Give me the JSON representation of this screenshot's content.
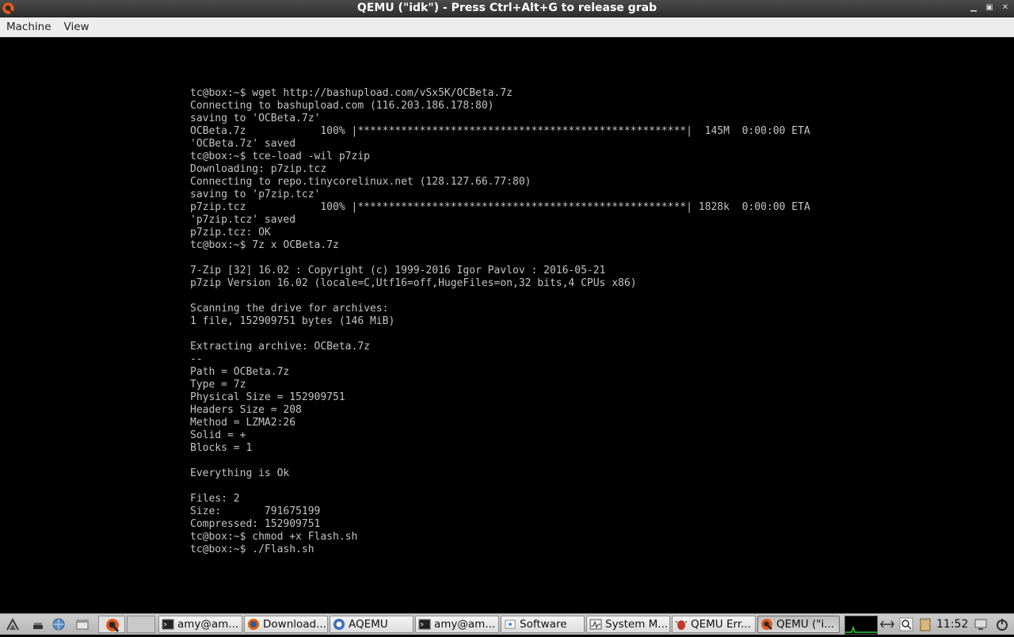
{
  "window": {
    "title": "QEMU (\"idk\") - Press Ctrl+Alt+G to release grab"
  },
  "menu": [
    "Machine",
    "View"
  ],
  "terminal": {
    "lines": [
      "tc@box:~$ wget http://bashupload.com/vSx5K/OCBeta.7z",
      "Connecting to bashupload.com (116.203.186.178:80)",
      "saving to 'OCBeta.7z'",
      "OCBeta.7z            100% |*****************************************************|  145M  0:00:00 ETA",
      "'OCBeta.7z' saved",
      "tc@box:~$ tce-load -wil p7zip",
      "Downloading: p7zip.tcz",
      "Connecting to repo.tinycorelinux.net (128.127.66.77:80)",
      "saving to 'p7zip.tcz'",
      "p7zip.tcz            100% |*****************************************************| 1828k  0:00:00 ETA",
      "'p7zip.tcz' saved",
      "p7zip.tcz: OK",
      "tc@box:~$ 7z x OCBeta.7z",
      "",
      "7-Zip [32] 16.02 : Copyright (c) 1999-2016 Igor Pavlov : 2016-05-21",
      "p7zip Version 16.02 (locale=C,Utf16=off,HugeFiles=on,32 bits,4 CPUs x86)",
      "",
      "Scanning the drive for archives:",
      "1 file, 152909751 bytes (146 MiB)",
      "",
      "Extracting archive: OCBeta.7z",
      "--",
      "Path = OCBeta.7z",
      "Type = 7z",
      "Physical Size = 152909751",
      "Headers Size = 208",
      "Method = LZMA2:26",
      "Solid = +",
      "Blocks = 1",
      "",
      "Everything is Ok",
      "",
      "Files: 2",
      "Size:       791675199",
      "Compressed: 152909751",
      "tc@box:~$ chmod +x Flash.sh",
      "tc@box:~$ ./Flash.sh"
    ]
  },
  "taskbar": {
    "launchers": [
      "start-menu-icon",
      "minimize-all-icon",
      "network-icon",
      "file-manager-icon",
      "qemu-icon"
    ],
    "tasks": [
      {
        "label": "amy@am...",
        "icon": "terminal-icon",
        "active": false
      },
      {
        "label": "Download...",
        "icon": "firefox-icon",
        "active": false
      },
      {
        "label": "AQEMU",
        "icon": "aqemu-icon",
        "active": false
      },
      {
        "label": "amy@am...",
        "icon": "terminal-icon",
        "active": false
      },
      {
        "label": "Software",
        "icon": "software-icon",
        "active": false
      },
      {
        "label": "System M...",
        "icon": "system-monitor-icon",
        "active": false
      },
      {
        "label": "QEMU Err...",
        "icon": "bug-icon",
        "active": false
      },
      {
        "label": "QEMU (\"i...",
        "icon": "qemu-icon",
        "active": true
      }
    ],
    "clock": "11:52",
    "colors": {
      "accent": "#e85a1a",
      "terminal_text": "#c4c4c4"
    }
  }
}
